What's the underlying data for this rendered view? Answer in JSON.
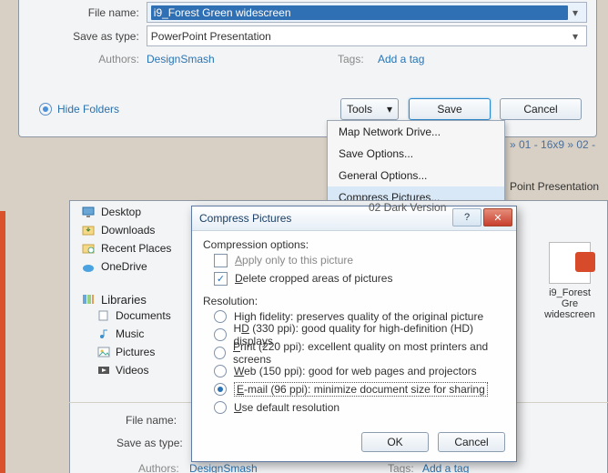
{
  "save_as": {
    "file_name_label": "File name:",
    "file_name_value": "i9_Forest Green widescreen",
    "save_type_label": "Save as type:",
    "save_type_value": "PowerPoint Presentation",
    "authors_label": "Authors:",
    "authors_value": "DesignSmash",
    "tags_label": "Tags:",
    "tags_value": "Add a tag",
    "hide_folders": "Hide Folders",
    "tools": "Tools",
    "save": "Save",
    "cancel": "Cancel"
  },
  "tools_menu": {
    "items": [
      "Map Network Drive...",
      "Save Options...",
      "General Options...",
      "Compress Pictures..."
    ]
  },
  "breadcrumb_tail": "» 01 - 16x9 » 02 -",
  "context_line": "Point Presentation",
  "version_line": "02 Dark Version",
  "sidebar": {
    "items": [
      "Desktop",
      "Downloads",
      "Recent Places",
      "OneDrive"
    ],
    "group": "Libraries",
    "libs": [
      "Documents",
      "Music",
      "Pictures",
      "Videos"
    ]
  },
  "thumb": {
    "line1": "i9_Forest Gre",
    "line2": "widescreen"
  },
  "bottom": {
    "file_name_label": "File name:",
    "save_type_label": "Save as type:",
    "authors_label": "Authors:",
    "authors_value": "DesignSmash",
    "tags_label": "Tags:",
    "tags_value": "Add a tag"
  },
  "dialog": {
    "title": "Compress Pictures",
    "section1": "Compression options:",
    "apply_only": "Apply only to this picture",
    "delete_cropped": "Delete cropped areas of pictures",
    "section2": "Resolution:",
    "r_high": "High fidelity: preserves quality of the original picture",
    "r_hd_pre": "H",
    "r_hd_acc": "D",
    "r_hd_rest": " (330 ppi): good quality for high-definition (HD) displays",
    "r_print_acc": "P",
    "r_print_rest": "rint (220 ppi): excellent quality on most printers and screens",
    "r_web_acc": "W",
    "r_web_rest": "eb (150 ppi): good for web pages and projectors",
    "r_email_acc": "E",
    "r_email_rest": "-mail (96 ppi): minimize document size for sharing",
    "r_default_acc": "U",
    "r_default_rest": "se default resolution",
    "ok": "OK",
    "cancel": "Cancel"
  }
}
